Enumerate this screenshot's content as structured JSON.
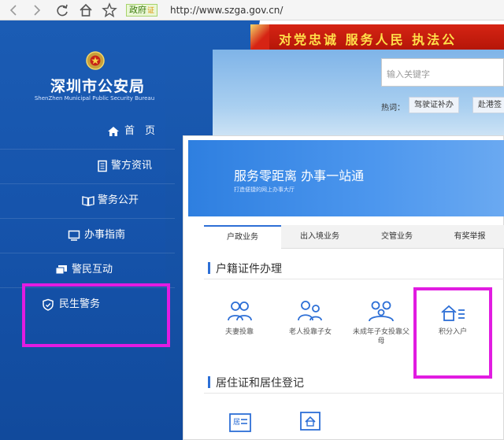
{
  "browser": {
    "badge_label": "政府",
    "badge_sub": "证",
    "url": "http://www.szga.gov.cn/"
  },
  "site": {
    "name_cn": "深圳市公安局",
    "name_en": "ShenZhen Municipal Public Security Bureau",
    "slogan": "对党忠诚 服务人民 执法公"
  },
  "search": {
    "placeholder": "输入关键字",
    "hot_label": "热词：",
    "tags": [
      "驾驶证补办",
      "赴港签"
    ]
  },
  "sidebar": {
    "items": [
      {
        "label": "首　页",
        "icon": "home-icon"
      },
      {
        "label": "警方资讯",
        "icon": "document-icon"
      },
      {
        "label": "警务公开",
        "icon": "book-icon"
      },
      {
        "label": "办事指南",
        "icon": "monitor-icon"
      },
      {
        "label": "警民互动",
        "icon": "chat-icon"
      },
      {
        "label": "民生警务",
        "icon": "shield-icon"
      }
    ]
  },
  "hero": {
    "title": "服务零距离  办事一站通",
    "subtitle": "打造便捷的网上办事大厅"
  },
  "tabs": [
    "户政业务",
    "出入境业务",
    "交管业务",
    "有奖举报"
  ],
  "sections": [
    {
      "title": "户籍证件办理",
      "services": [
        {
          "label": "夫妻投靠",
          "icon": "couple-icon"
        },
        {
          "label": "老人投靠子女",
          "icon": "elder-icon"
        },
        {
          "label": "未成年子女投靠父母",
          "icon": "family-icon"
        },
        {
          "label": "积分入户",
          "icon": "house-icon"
        }
      ]
    },
    {
      "title": "居住证和居住登记",
      "services": [
        {
          "label": "",
          "icon": "residence-card-icon"
        },
        {
          "label": "",
          "icon": "residence-register-icon"
        }
      ]
    }
  ],
  "colors": {
    "sidebar_blue": "#1654ac",
    "accent_blue": "#2d6fd6",
    "highlight_magenta": "#e11ce1",
    "banner_red": "#c81c0c"
  }
}
